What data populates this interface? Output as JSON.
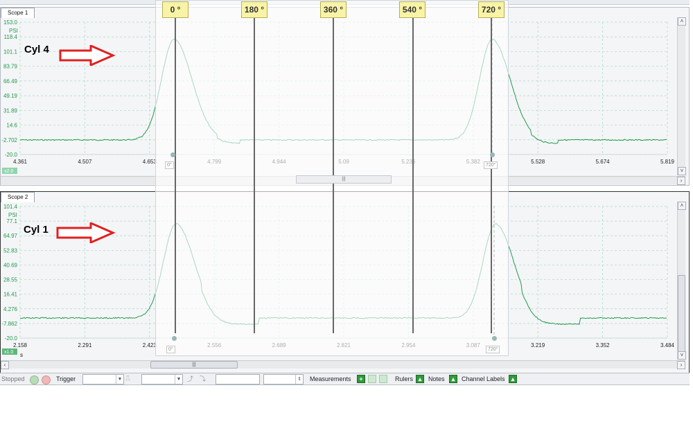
{
  "scope1": {
    "tab_label": "Scope 1",
    "y_unit": "PSI",
    "y_ticks": [
      "153.0",
      "118.4",
      "101.1",
      "83.79",
      "66.49",
      "49.19",
      "31.89",
      "14.6",
      "-2.702",
      "-20.0"
    ],
    "x_unit": "s",
    "x_ticks": [
      "4.361",
      "4.507",
      "4.653",
      "4.799",
      "4.944",
      "5.09",
      "5.236",
      "5.382",
      "5.528",
      "5.674",
      "5.819"
    ],
    "zoom_badge": "x2.0",
    "annotation": "Cyl 4"
  },
  "scope2": {
    "tab_label": "Scope 2",
    "y_unit": "PSI",
    "y_ticks": [
      "101.4",
      "77.1",
      "64.97",
      "52.83",
      "40.69",
      "28.55",
      "16.41",
      "4.276",
      "-7.862",
      "-20.0"
    ],
    "x_unit": "s",
    "x_ticks": [
      "2.158",
      "2.291",
      "2.423",
      "2.556",
      "2.689",
      "2.821",
      "2.954",
      "3.087",
      "3.219",
      "3.352",
      "3.484"
    ],
    "zoom_badge": "x1.0",
    "annotation": "Cyl 1"
  },
  "ruler_overlay": {
    "labels": [
      "0 °",
      "180 °",
      "360 °",
      "540 °",
      "720 °"
    ],
    "start_label": "0°",
    "end_label": "720°"
  },
  "statusbar": {
    "state": "Stopped",
    "trigger_label": "Trigger",
    "measurements_label": "Measurements",
    "rulers_label": "Rulers",
    "notes_label": "Notes",
    "channel_labels_label": "Channel Labels"
  },
  "colors": {
    "trace": "#1f9a4a",
    "trace_faded": "#9fd6b4",
    "axis_text": "#1f9a4a",
    "grid": "#a7d7c1",
    "ruler_label_bg": "#f8f3a6",
    "arrow": "#e02020",
    "overlay_tint": "#ffffff"
  }
}
